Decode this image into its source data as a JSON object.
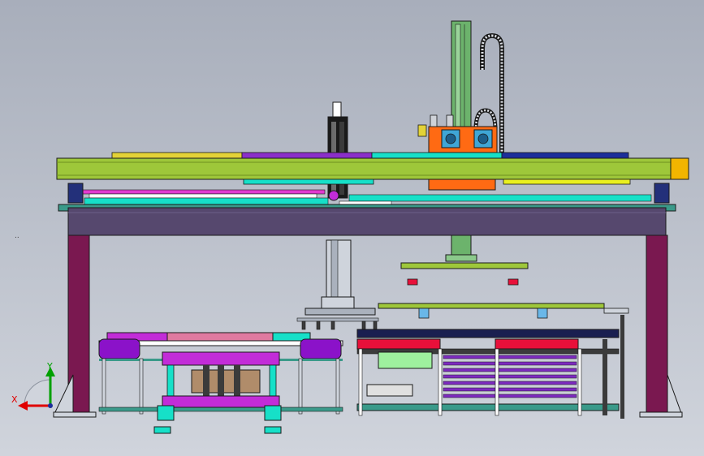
{
  "view": {
    "axis_x_label": "X",
    "axis_y_label": "Y",
    "stray_mark": ".."
  },
  "colors": {
    "background": "#b6bcc7",
    "beam": "#9ec73a",
    "girder": "#56486e",
    "column": "#7a1850",
    "carriage": "#ff6a13",
    "mast": "#6cb36c",
    "cyan": "#16e0c8",
    "magenta": "#c22cd8",
    "red": "#e8103a",
    "blue": "#1c2e9a",
    "navy": "#1a1f50"
  }
}
